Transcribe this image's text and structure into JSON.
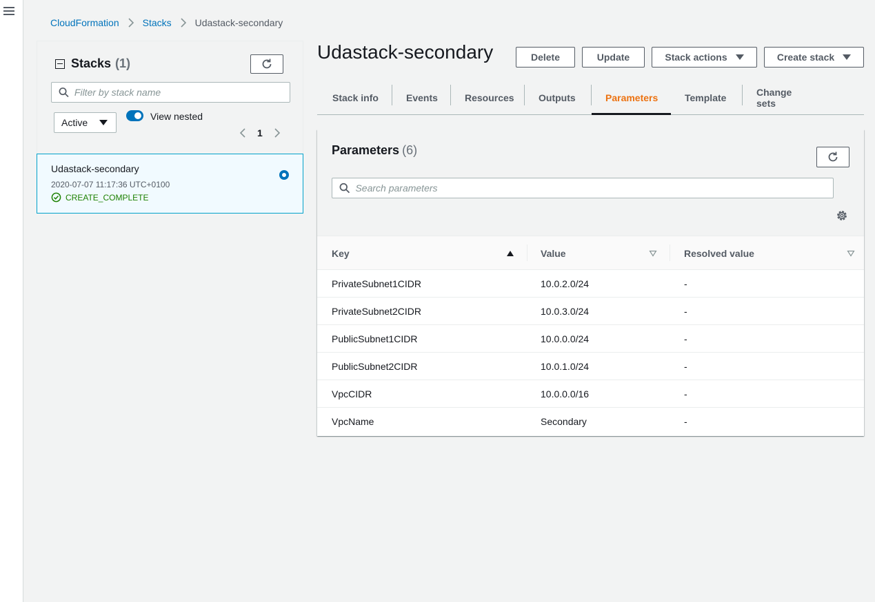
{
  "breadcrumb": {
    "root": "CloudFormation",
    "stacks": "Stacks",
    "current": "Udastack-secondary"
  },
  "stacks_panel": {
    "title": "Stacks",
    "count": "(1)",
    "filter_placeholder": "Filter by stack name",
    "status_filter": "Active",
    "view_nested_label": "View nested",
    "view_nested_on": true,
    "page": "1",
    "items": [
      {
        "name": "Udastack-secondary",
        "created": "2020-07-07 11:17:36 UTC+0100",
        "status": "CREATE_COMPLETE",
        "selected": true
      }
    ]
  },
  "stack": {
    "name": "Udastack-secondary",
    "actions": {
      "delete": "Delete",
      "update": "Update",
      "stack_actions": "Stack actions",
      "create_stack": "Create stack"
    },
    "tabs": [
      "Stack info",
      "Events",
      "Resources",
      "Outputs",
      "Parameters",
      "Template",
      "Change sets"
    ],
    "active_tab": "Parameters"
  },
  "parameters": {
    "title": "Parameters",
    "count": "(6)",
    "search_placeholder": "Search parameters",
    "columns": {
      "key": "Key",
      "value": "Value",
      "resolved": "Resolved value"
    },
    "rows": [
      {
        "key": "PrivateSubnet1CIDR",
        "value": "10.0.2.0/24",
        "resolved": "-"
      },
      {
        "key": "PrivateSubnet2CIDR",
        "value": "10.0.3.0/24",
        "resolved": "-"
      },
      {
        "key": "PublicSubnet1CIDR",
        "value": "10.0.0.0/24",
        "resolved": "-"
      },
      {
        "key": "PublicSubnet2CIDR",
        "value": "10.0.1.0/24",
        "resolved": "-"
      },
      {
        "key": "VpcCIDR",
        "value": "10.0.0.0/16",
        "resolved": "-"
      },
      {
        "key": "VpcName",
        "value": "Secondary",
        "resolved": "-"
      }
    ]
  },
  "colors": {
    "link": "#0073bb",
    "active_tab": "#ec7211",
    "success": "#1d8102",
    "selected_border": "#00a1c9"
  }
}
